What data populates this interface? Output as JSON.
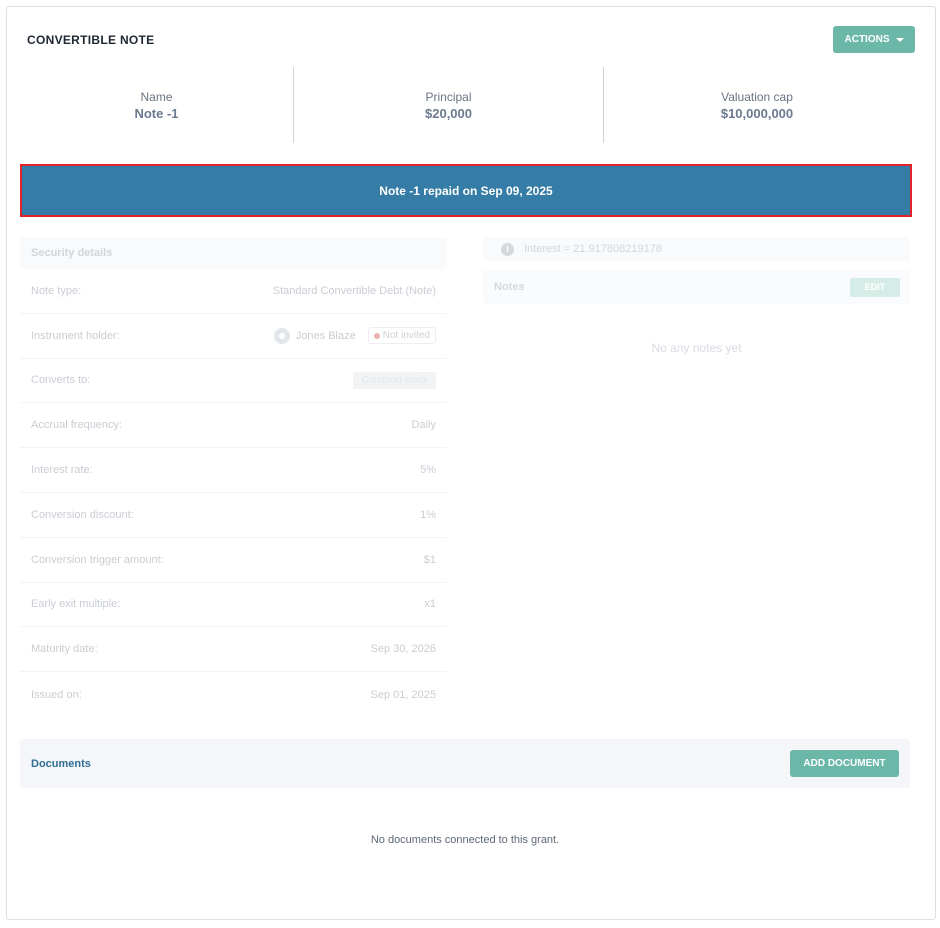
{
  "header": {
    "title": "CONVERTIBLE NOTE",
    "actions_label": "ACTIONS"
  },
  "summary": [
    {
      "label": "Name",
      "value": "Note -1"
    },
    {
      "label": "Principal",
      "value": "$20,000"
    },
    {
      "label": "Valuation cap",
      "value": "$10,000,000"
    }
  ],
  "banner": {
    "text": "Note -1 repaid on Sep 09, 2025"
  },
  "security_details": {
    "title": "Security details",
    "rows": [
      {
        "label": "Note type:",
        "value": "Standard Convertible Debt (Note)"
      },
      {
        "label": "Instrument holder:",
        "value": "Jones Blaze",
        "badge": "Not invited"
      },
      {
        "label": "Converts to:",
        "value": "Common stock"
      },
      {
        "label": "Accrual frequency:",
        "value": "Daily"
      },
      {
        "label": "Interest rate:",
        "value": "5%"
      },
      {
        "label": "Conversion discount:",
        "value": "1%"
      },
      {
        "label": "Conversion trigger amount:",
        "value": "$1"
      },
      {
        "label": "Early exit multiple:",
        "value": "x1"
      },
      {
        "label": "Maturity date:",
        "value": "Sep 30, 2026"
      },
      {
        "label": "Issued on:",
        "value": "Sep 01, 2025"
      }
    ]
  },
  "interest": {
    "text": "Interest = 21.917808219178"
  },
  "notes": {
    "title": "Notes",
    "edit_label": "EDIT",
    "empty_text": "No any notes yet"
  },
  "documents": {
    "title": "Documents",
    "add_label": "ADD DOCUMENT",
    "empty_text": "No documents connected to this grant."
  },
  "colors": {
    "accent": "#6cb8a8",
    "banner": "#357ca6",
    "banner_border": "#e0242b"
  }
}
